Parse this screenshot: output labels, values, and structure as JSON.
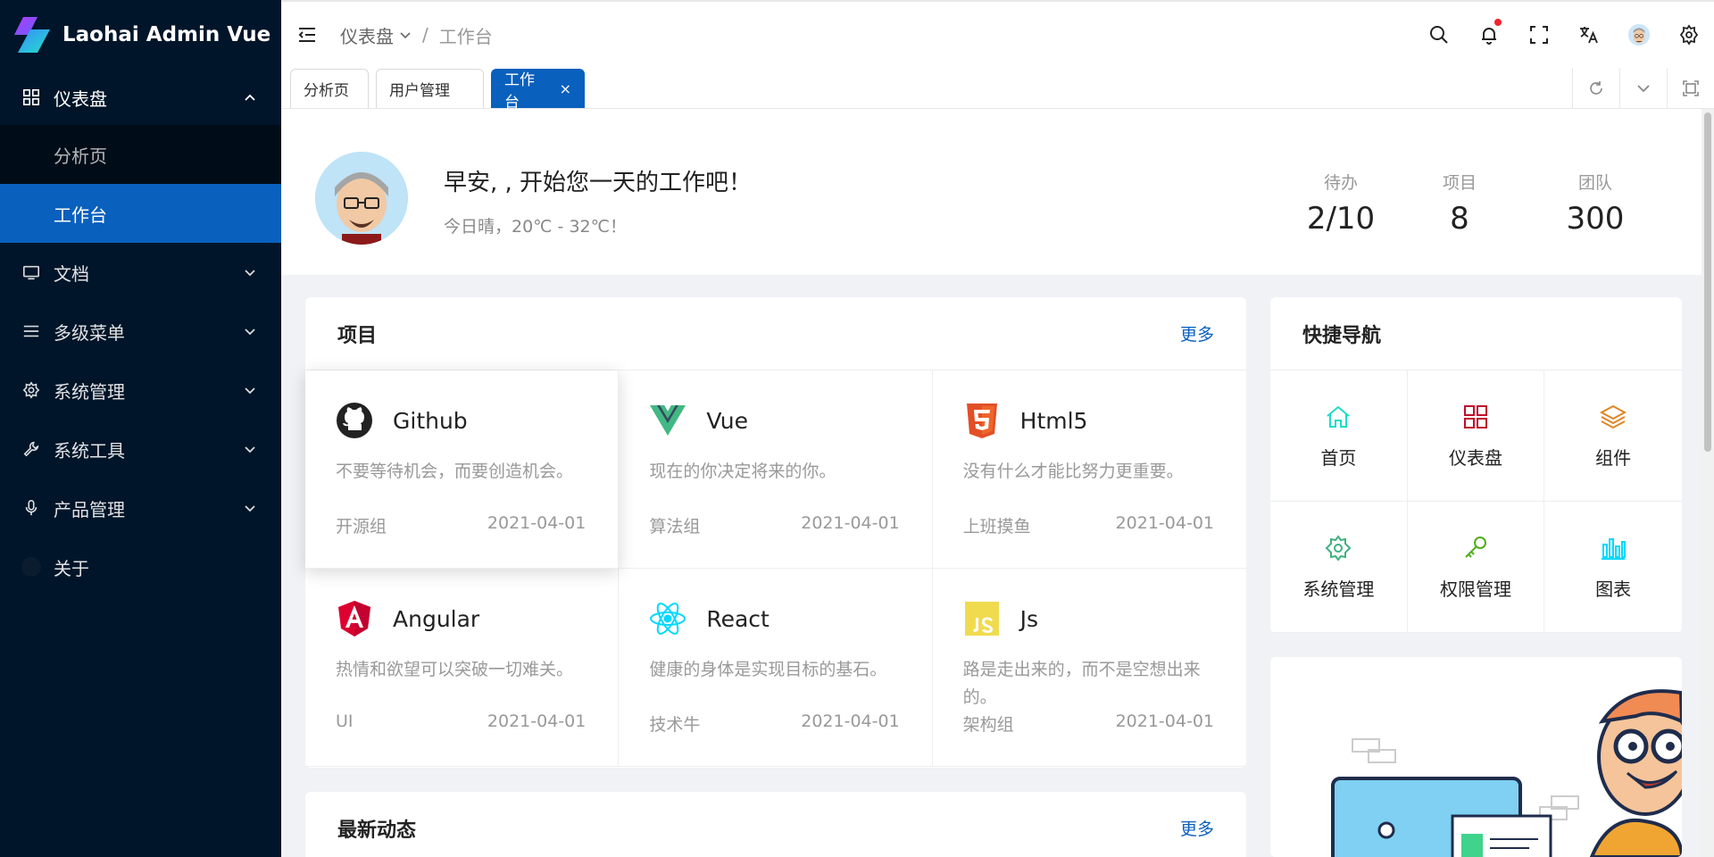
{
  "app": {
    "title": "Laohai Admin Vue"
  },
  "sidebar": {
    "items": [
      {
        "label": "仪表盘",
        "icon": "dashboard-icon",
        "open": true,
        "children": [
          {
            "label": "分析页",
            "active": false
          },
          {
            "label": "工作台",
            "active": true
          }
        ]
      },
      {
        "label": "文档",
        "icon": "monitor-icon"
      },
      {
        "label": "多级菜单",
        "icon": "menu-lines-icon"
      },
      {
        "label": "系统管理",
        "icon": "gear-icon"
      },
      {
        "label": "系统工具",
        "icon": "wrench-icon"
      },
      {
        "label": "产品管理",
        "icon": "microphone-icon"
      },
      {
        "label": "关于",
        "icon": "circle-icon"
      }
    ]
  },
  "header": {
    "breadcrumb": {
      "parent": "仪表盘",
      "separator": "/",
      "current": "工作台"
    },
    "icons": [
      "search-icon",
      "bell-icon",
      "fullscreen-icon",
      "translate-icon",
      "user-avatar",
      "settings-icon"
    ]
  },
  "tabs": {
    "items": [
      {
        "label": "分析页"
      },
      {
        "label": "用户管理"
      },
      {
        "label": "工作台",
        "active": true,
        "close": "×"
      }
    ]
  },
  "welcome": {
    "greeting": "早安, , 开始您一天的工作吧！",
    "weather": "今日晴，20℃ - 32℃！",
    "stats": [
      {
        "label": "待办",
        "value": "2/10"
      },
      {
        "label": "项目",
        "value": "8"
      },
      {
        "label": "团队",
        "value": "300"
      }
    ]
  },
  "projects": {
    "title": "项目",
    "more": "更多",
    "items": [
      {
        "name": "Github",
        "icon": "github-icon",
        "desc": "不要等待机会，而要创造机会。",
        "group": "开源组",
        "date": "2021-04-01"
      },
      {
        "name": "Vue",
        "icon": "vue-icon",
        "desc": "现在的你决定将来的你。",
        "group": "算法组",
        "date": "2021-04-01"
      },
      {
        "name": "Html5",
        "icon": "html5-icon",
        "desc": "没有什么才能比努力更重要。",
        "group": "上班摸鱼",
        "date": "2021-04-01"
      },
      {
        "name": "Angular",
        "icon": "angular-icon",
        "desc": "热情和欲望可以突破一切难关。",
        "group": "UI",
        "date": "2021-04-01"
      },
      {
        "name": "React",
        "icon": "react-icon",
        "desc": "健康的身体是实现目标的基石。",
        "group": "技术牛",
        "date": "2021-04-01"
      },
      {
        "name": "Js",
        "icon": "js-icon",
        "desc": "路是走出来的，而不是空想出来的。",
        "group": "架构组",
        "date": "2021-04-01"
      }
    ]
  },
  "quicknav": {
    "title": "快捷导航",
    "items": [
      {
        "label": "首页",
        "icon": "home-icon",
        "color": "#1fdaca"
      },
      {
        "label": "仪表盘",
        "icon": "grid-icon",
        "color": "#bf0c2c"
      },
      {
        "label": "组件",
        "icon": "layers-icon",
        "color": "#e18525"
      },
      {
        "label": "系统管理",
        "icon": "gear-icon",
        "color": "#3fb27f"
      },
      {
        "label": "权限管理",
        "icon": "key-icon",
        "color": "#4daf1b"
      },
      {
        "label": "图表",
        "icon": "bar-chart-icon",
        "color": "#00d8ff"
      }
    ]
  },
  "activity": {
    "title": "最新动态",
    "more": "更多"
  },
  "colors": {
    "sidebar_bg": "#001529",
    "primary": "#0960bd",
    "submenu_bg": "#000c17"
  }
}
